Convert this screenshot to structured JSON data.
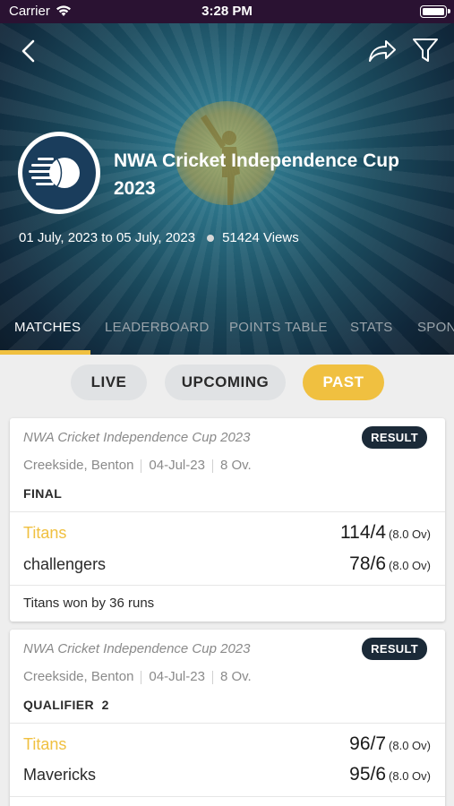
{
  "status_bar": {
    "carrier": "Carrier",
    "time": "3:28 PM"
  },
  "header": {
    "title": "NWA Cricket Independence Cup 2023",
    "dates": "01 July, 2023 to 05 July, 2023",
    "views": "51424 Views"
  },
  "tabs": [
    "MATCHES",
    "LEADERBOARD",
    "POINTS TABLE",
    "STATS",
    "SPON"
  ],
  "filters": {
    "live": "LIVE",
    "upcoming": "UPCOMING",
    "past": "PAST",
    "selected": "PAST"
  },
  "colors": {
    "accent": "#f0c040",
    "badge": "#1b2a38",
    "status_bar": "#2a1232"
  },
  "matches": [
    {
      "tournament": "NWA Cricket Independence Cup 2023",
      "badge": "RESULT",
      "venue": "Creekside, Benton",
      "date": "04-Jul-23",
      "overs": "8 Ov.",
      "stage": "FINAL",
      "team1": {
        "name": "Titans",
        "score": "114/4",
        "overs": "(8.0 Ov)"
      },
      "team2": {
        "name": "challengers",
        "score": "78/6",
        "overs": "(8.0 Ov)"
      },
      "result": "Titans won by 36 runs"
    },
    {
      "tournament": "NWA Cricket Independence Cup 2023",
      "badge": "RESULT",
      "venue": "Creekside, Benton",
      "date": "04-Jul-23",
      "overs": "8 Ov.",
      "stage": "QUALIFIER  2",
      "team1": {
        "name": "Titans",
        "score": "96/7",
        "overs": "(8.0 Ov)"
      },
      "team2": {
        "name": "Mavericks",
        "score": "95/6",
        "overs": "(8.0 Ov)"
      }
    }
  ]
}
